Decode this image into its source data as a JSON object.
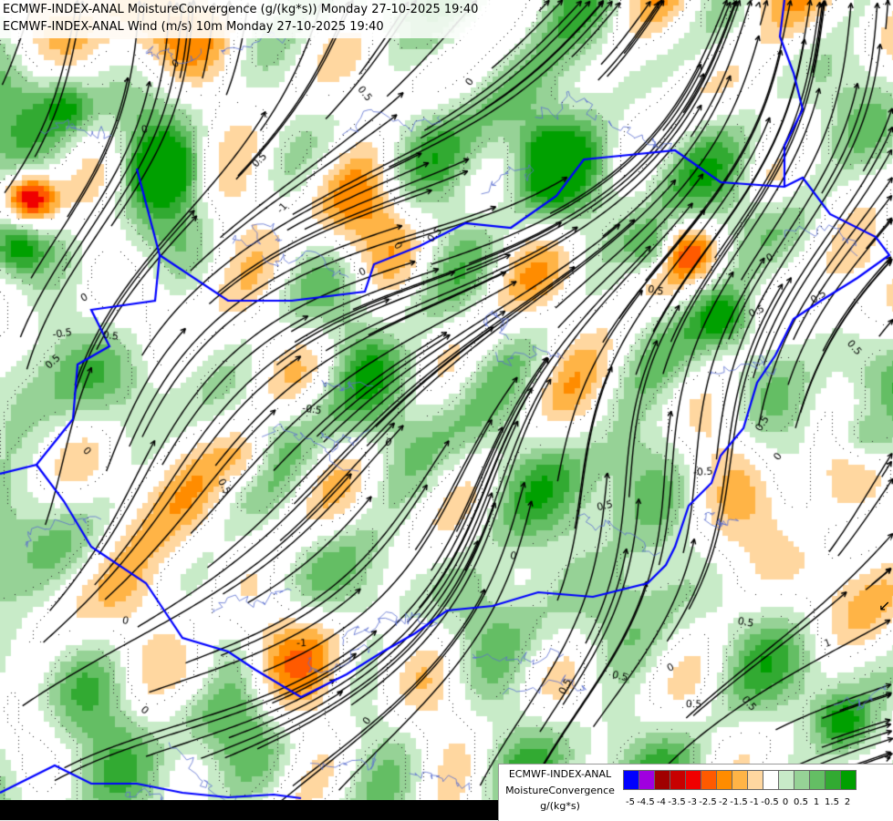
{
  "header": {
    "line1": "ECMWF-INDEX-ANAL MoistureConvergence (g/(kg*s)) Monday 27-10-2025 19:40",
    "line2": "ECMWF-INDEX-ANAL Wind (m/s) 10m Monday 27-10-2025 19:40"
  },
  "legend": {
    "line1": "ECMWF-INDEX-ANAL",
    "line2": "MoistureConvergence",
    "line3": "g/(kg*s)",
    "colors": [
      "#0000ff",
      "#a000e0",
      "#a00000",
      "#c80000",
      "#f00000",
      "#ff5a00",
      "#ff8c00",
      "#ffb446",
      "#ffd7a0",
      "#ffffff",
      "#c8ebc8",
      "#96d296",
      "#64be64",
      "#32aa32",
      "#00a000"
    ],
    "ticks": [
      "-5",
      "-4.5",
      "-4",
      "-3.5",
      "-3",
      "-2.5",
      "-2",
      "-1.5",
      "-1",
      "-0.5",
      "0",
      "0.5",
      "1",
      "1.5",
      "2"
    ]
  },
  "map": {
    "contour_labels": [
      "0.5",
      "0",
      "-0.5",
      "0.5",
      "0",
      "0.5",
      "-0.5",
      "0.5",
      "0",
      "0.5",
      "0",
      "-1",
      "0.5",
      "0",
      "0.5",
      "0",
      "0.5",
      "-0.5",
      "0",
      "0.5",
      "0",
      "1",
      "0.5",
      "0",
      "0.5",
      "-1",
      "0",
      "0.5",
      "0",
      "0.5",
      "0",
      "0.5",
      "0",
      "0.5",
      "0.5",
      "0",
      "0.5",
      "0"
    ],
    "colors": {
      "border": "#0000ff",
      "river": "#5a6fd0",
      "streamline": "#000000",
      "contour": "#000000"
    }
  }
}
